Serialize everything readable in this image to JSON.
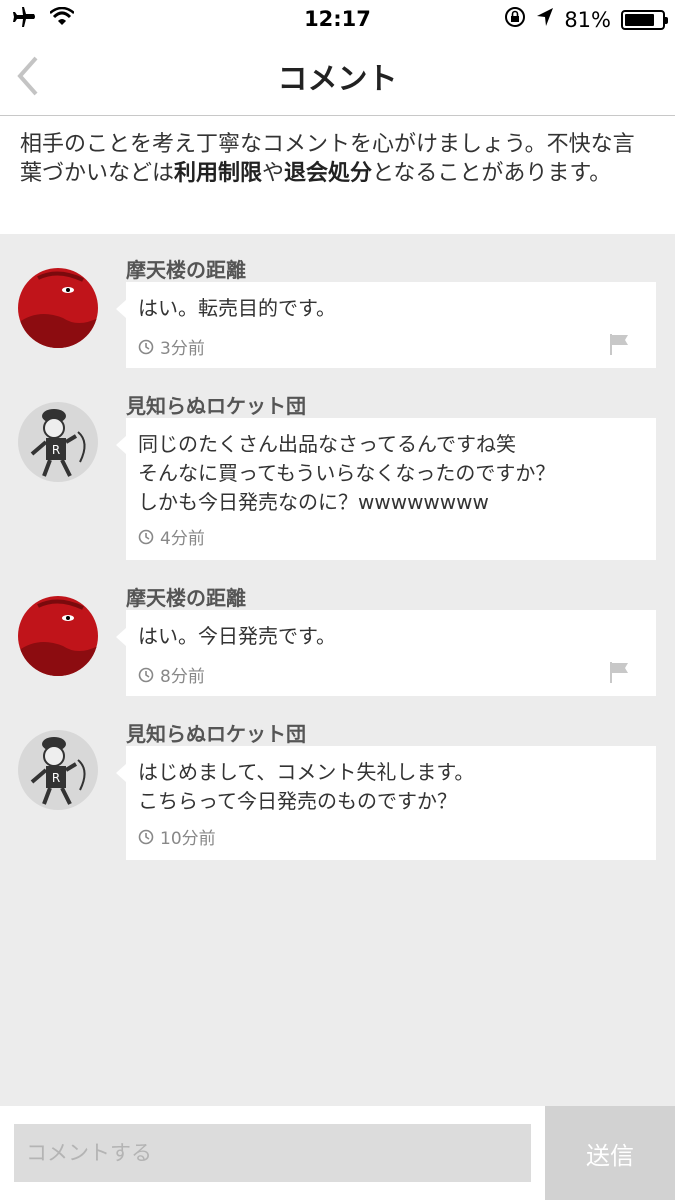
{
  "status_bar": {
    "time": "12:17",
    "battery_text": "81%",
    "battery_level": 0.81,
    "icons": [
      "airplane-icon",
      "wifi-icon",
      "orientation-lock-icon",
      "location-icon",
      "battery-icon"
    ]
  },
  "nav": {
    "title": "コメント",
    "back_icon": "chevron-left-icon"
  },
  "notice": {
    "part1": "相手のことを考え丁寧なコメントを心がけましょう。不快な言葉づかいなどは",
    "bold1": "利用制限",
    "part2": "や",
    "bold2": "退会処分",
    "part3": "となることがあります。"
  },
  "comments": [
    {
      "user": "摩天楼の距離",
      "message": "はい。転売目的です。",
      "time": "3分前",
      "avatar": "red-face-avatar",
      "has_flag": true
    },
    {
      "user": "見知らぬロケット団",
      "message": "同じのたくさん出品なさってるんですね笑\nそんなに買ってもういらなくなったのですか？\nしかも今日発売なのに？wwwwwwww",
      "time": "4分前",
      "avatar": "rocket-grunt-avatar",
      "has_flag": false
    },
    {
      "user": "摩天楼の距離",
      "message": "はい。今日発売です。",
      "time": "8分前",
      "avatar": "red-face-avatar",
      "has_flag": true
    },
    {
      "user": "見知らぬロケット団",
      "message": "はじめまして、コメント失礼します。\nこちらって今日発売のものですか？",
      "time": "10分前",
      "avatar": "rocket-grunt-avatar",
      "has_flag": false
    }
  ],
  "input": {
    "placeholder": "コメントする",
    "value": ""
  },
  "send_label": "送信",
  "colors": {
    "background": "#ececec",
    "send_button": "#d2d2d2",
    "input_field": "#dcdcdc",
    "avatar_red": "#c0141a"
  }
}
